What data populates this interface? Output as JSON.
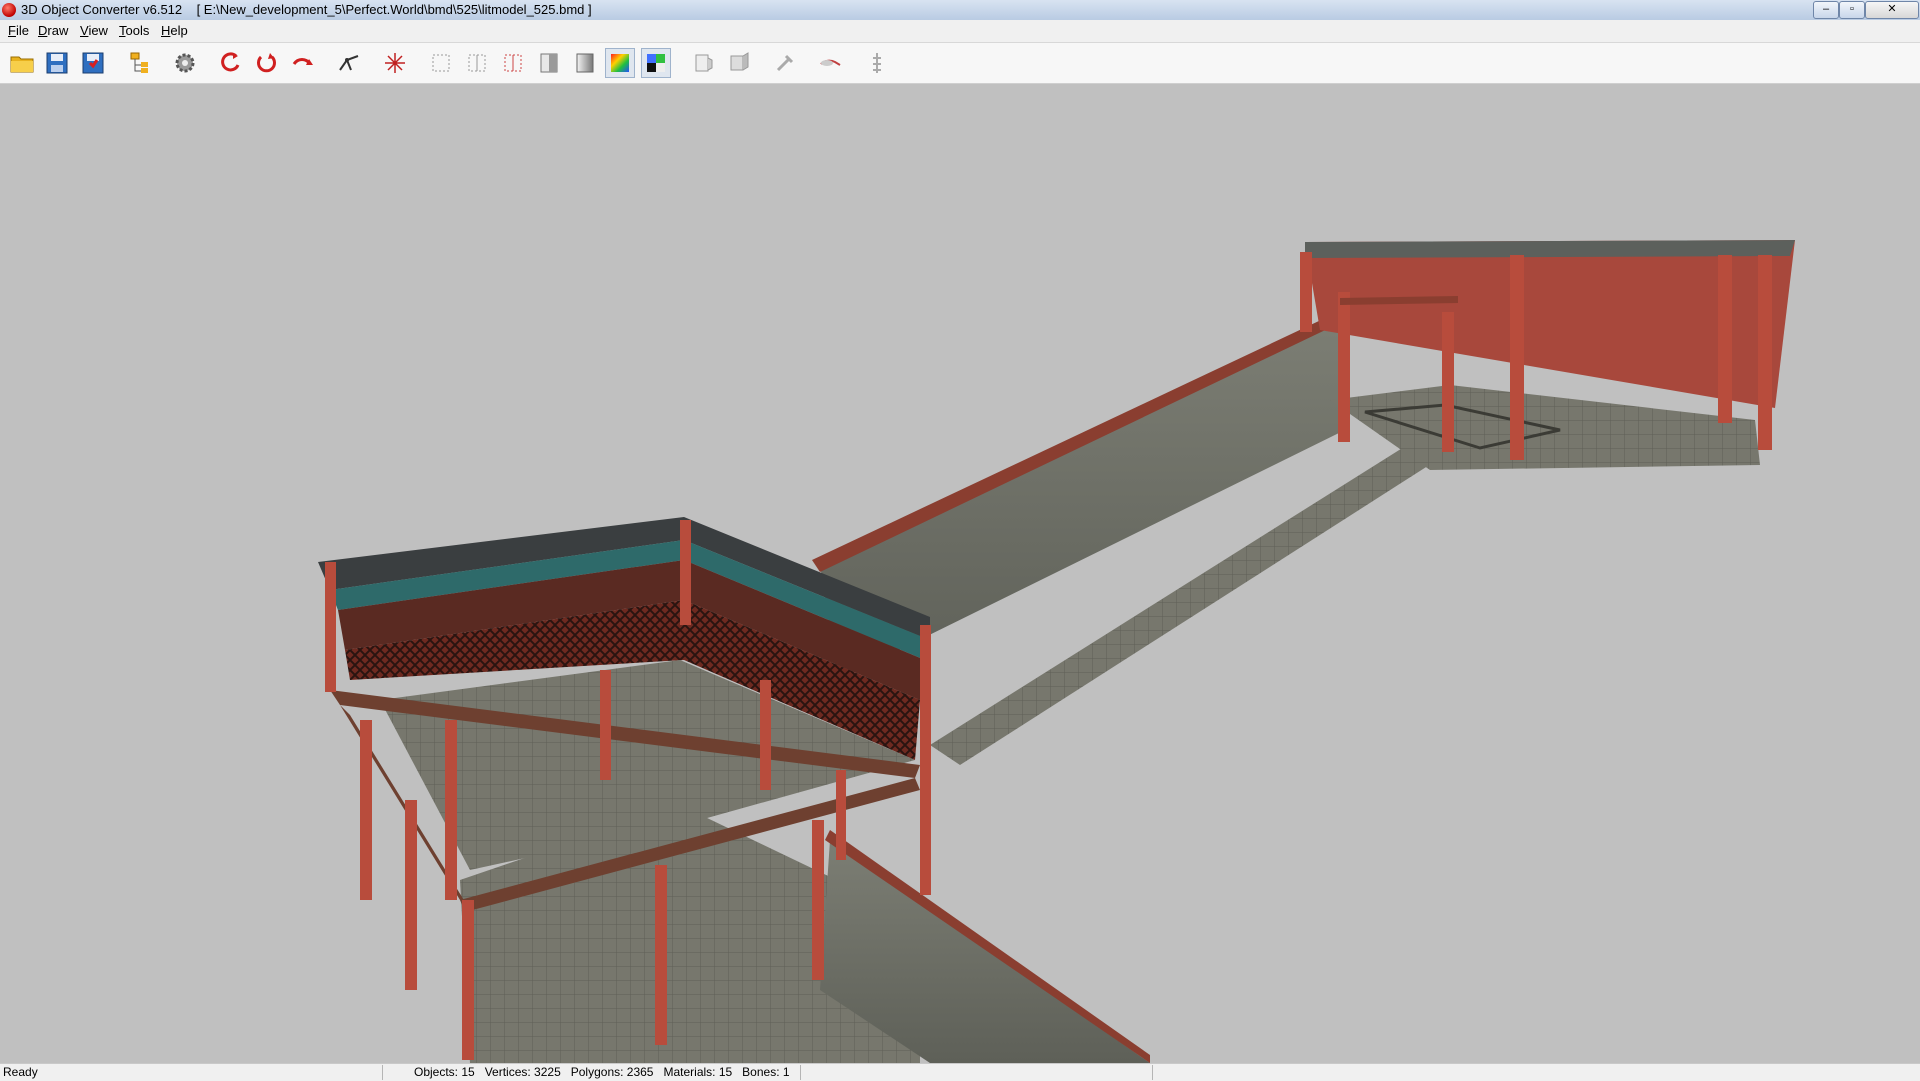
{
  "window": {
    "title": "3D Object Converter v6.512    [ E:\\New_development_5\\Perfect.World\\bmd\\525\\litmodel_525.bmd ]",
    "controls": [
      "–",
      "▫",
      "✕"
    ]
  },
  "menu": [
    {
      "label": "File",
      "accel": "F"
    },
    {
      "label": "Draw",
      "accel": "D"
    },
    {
      "label": "View",
      "accel": "V"
    },
    {
      "label": "Tools",
      "accel": "T"
    },
    {
      "label": "Help",
      "accel": "H"
    }
  ],
  "toolbar": [
    {
      "icon": "open-folder-icon",
      "name": "open-button"
    },
    {
      "icon": "save-icon",
      "name": "save-button"
    },
    {
      "icon": "save-as-icon",
      "name": "save-as-button"
    },
    {
      "icon": "object-tree-icon",
      "name": "object-tree-button"
    },
    {
      "icon": "settings-gear-icon",
      "name": "settings-button"
    },
    {
      "icon": "rotate-x-icon",
      "name": "rotate-x-button"
    },
    {
      "icon": "rotate-y-icon",
      "name": "rotate-y-button"
    },
    {
      "icon": "rotate-z-icon",
      "name": "rotate-z-button"
    },
    {
      "icon": "vertices-icon",
      "name": "vertices-button"
    },
    {
      "icon": "center-icon",
      "name": "center-button"
    },
    {
      "icon": "view-front-icon",
      "name": "view-front-button"
    },
    {
      "icon": "view-side-icon",
      "name": "view-side-button"
    },
    {
      "icon": "view-top-icon",
      "name": "view-top-button"
    },
    {
      "icon": "flat-shade-icon",
      "name": "flat-shade-button"
    },
    {
      "icon": "smooth-shade-icon",
      "name": "smooth-shade-button"
    },
    {
      "icon": "color-mode-icon",
      "name": "color-mode-button"
    },
    {
      "icon": "texture-mode-icon",
      "name": "texture-mode-button"
    },
    {
      "icon": "light-front-icon",
      "name": "light-front-button"
    },
    {
      "icon": "light-side-icon",
      "name": "light-side-button"
    },
    {
      "icon": "tool-icon",
      "name": "tool-button"
    },
    {
      "icon": "hand-icon",
      "name": "hand-button"
    },
    {
      "icon": "bones-icon",
      "name": "bones-button"
    }
  ],
  "status": {
    "ready": "Ready",
    "stats": "Objects: 15   Vertices: 3225   Polygons: 2365   Materials: 15   Bones: 1"
  },
  "colors": {
    "viewport_bg": "#c0c0c0",
    "wall_red": "#a8483c",
    "stone": "#7a7a70",
    "pillar": "#b84c3c",
    "roof": "#3a3e40"
  }
}
